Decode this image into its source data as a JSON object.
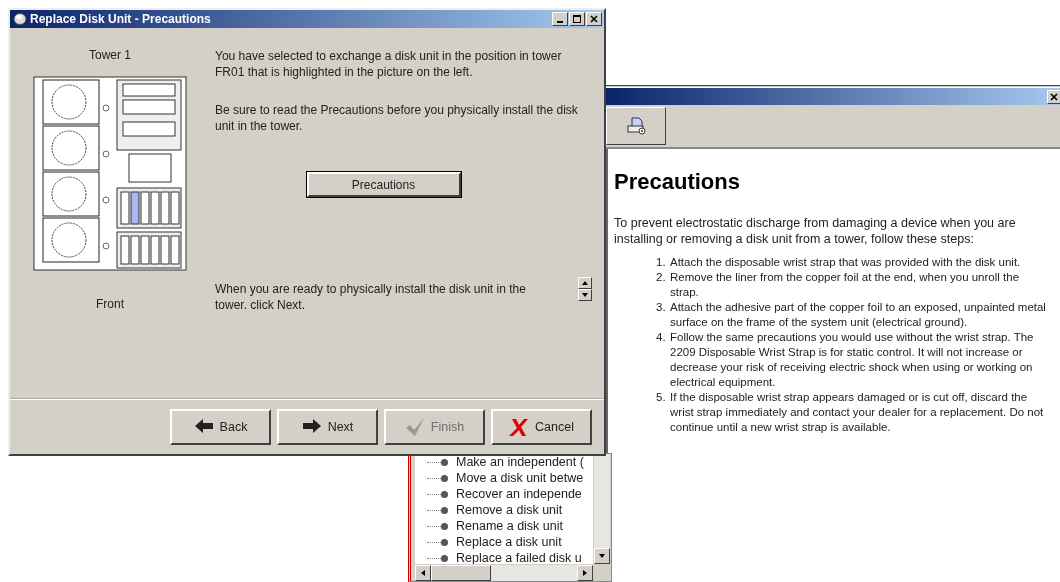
{
  "dialog": {
    "title": "Replace Disk Unit - Precautions",
    "tower_label": "Tower 1",
    "tower_caption": "Front",
    "messages": [
      "You have selected to exchange a disk unit in the position in tower FR01 that is highlighted in the picture on the left.",
      "Be sure to read the Precautions before you physically install the disk unit in the tower."
    ],
    "precautions_button": "Precautions",
    "final_message": "When you are ready to physically install the disk unit in the tower. click Next.",
    "buttons": [
      {
        "label": "Back",
        "kind": "back",
        "disabled": false
      },
      {
        "label": "Next",
        "kind": "next",
        "disabled": false
      },
      {
        "label": "Finish",
        "kind": "finish",
        "disabled": true
      },
      {
        "label": "Cancel",
        "kind": "cancel",
        "disabled": false
      }
    ]
  },
  "topic_tree": {
    "items": [
      "Make an independent (",
      "Move a disk unit betwe",
      "Recover an independe",
      "Remove a disk unit",
      "Rename a disk unit",
      "Replace a disk unit",
      "Replace a failed disk u"
    ]
  },
  "help_window": {
    "heading": "Precautions",
    "intro": "To prevent electrostatic discharge from damaging a device when you are installing or removing a disk unit from a tower, follow these steps:",
    "steps": [
      {
        "number": "1.",
        "text": "Attach the disposable wrist strap that was provided with the disk unit."
      },
      {
        "number": "2.",
        "text": "Remove the liner from the copper foil at the end, when you unroll the strap."
      },
      {
        "number": "3.",
        "text": "Attach the adhesive part of the copper foil to an exposed, unpainted metal surface on the frame of the system unit (electrical ground)."
      },
      {
        "number": "4.",
        "text": "Follow the same precautions you would use without the wrist strap. The 2209 Disposable Wrist Strap is for static control. It will not increase or decrease your risk of receiving electric shock when using or working on electrical equipment."
      },
      {
        "number": "5.",
        "text": "If the disposable wrist strap appears damaged or is cut off, discard the wrist strap immediately and contact your dealer for a replacement. Do not continue until a new wrist strap is available."
      }
    ]
  }
}
